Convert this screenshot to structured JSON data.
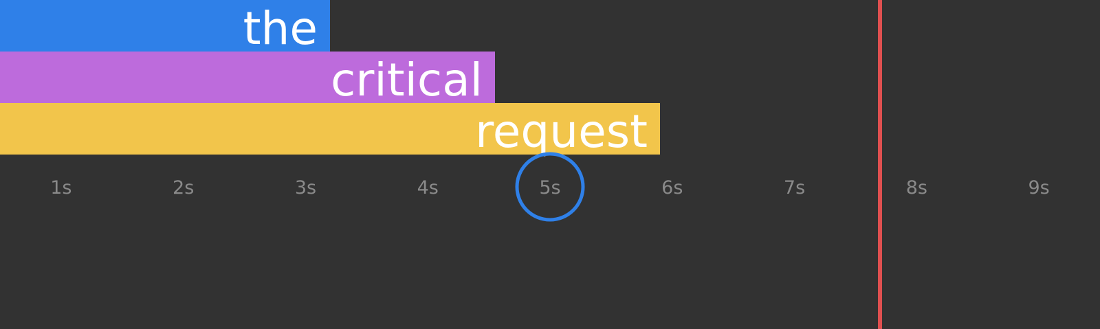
{
  "chart_data": {
    "type": "bar",
    "orientation": "horizontal",
    "categories": [
      "the",
      "critical",
      "request"
    ],
    "values": [
      3.2,
      4.55,
      5.9
    ],
    "colors": [
      "#2f80e8",
      "#bd6bdc",
      "#f2c54b"
    ],
    "x_ticks": [
      "1s",
      "2s",
      "3s",
      "4s",
      "5s",
      "6s",
      "7s",
      "8s",
      "9s"
    ],
    "x_tick_values": [
      1,
      2,
      3,
      4,
      5,
      6,
      7,
      8,
      9
    ],
    "xlim": [
      0.5,
      9.5
    ],
    "marker_line": {
      "value": 7.7,
      "color": "#e05050"
    },
    "highlight_circle": {
      "value": 5,
      "color": "#2f80e8"
    },
    "grid": false,
    "legend": "none",
    "title": "",
    "xlabel": "",
    "ylabel": ""
  },
  "colors": {
    "background": "#323232",
    "tick_text": "#8a8a8a",
    "bar_text": "#ffffff"
  }
}
